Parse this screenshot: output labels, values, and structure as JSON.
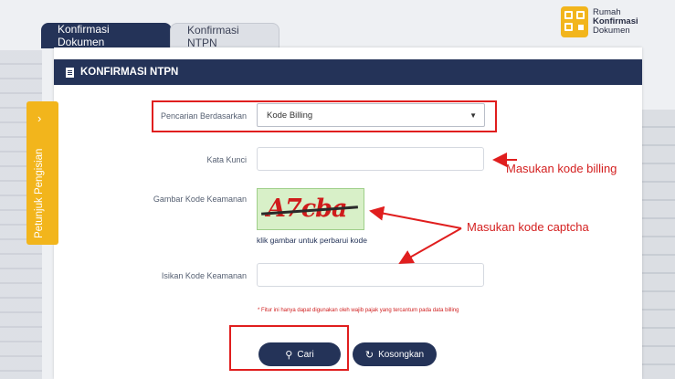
{
  "logo": {
    "line1": "Rumah",
    "line2": "Konfirmasi",
    "line3": "Dokumen"
  },
  "tabs": [
    {
      "label": "Konfirmasi Dokumen",
      "active": true
    },
    {
      "label": "Konfirmasi NTPN",
      "active": false
    }
  ],
  "panel": {
    "title": "KONFIRMASI NTPN"
  },
  "side_tab": {
    "label": "Petunjuk Pengisian",
    "icon": "chevron-right-icon"
  },
  "form": {
    "search_by_label": "Pencarian Berdasarkan",
    "search_by_value": "Kode Billing",
    "keyword_label": "Kata Kunci",
    "keyword_value": "",
    "captcha_label": "Gambar Kode Keamanan",
    "captcha_text": "A7cba",
    "captcha_refresh": "klik gambar untuk perbarui kode",
    "captcha_input_label": "Isikan Kode Keamanan",
    "captcha_input_value": "",
    "note": "* Fitur ini hanya dapat digunakan oleh wajib pajak yang tercantum pada data billing"
  },
  "buttons": {
    "search": "Cari",
    "clear": "Kosongkan"
  },
  "annotations": {
    "billing": "Masukan kode billing",
    "captcha": "Masukan kode captcha"
  },
  "colors": {
    "navy": "#243358",
    "accent": "#f2b51c",
    "annotation": "#e01e1e"
  }
}
